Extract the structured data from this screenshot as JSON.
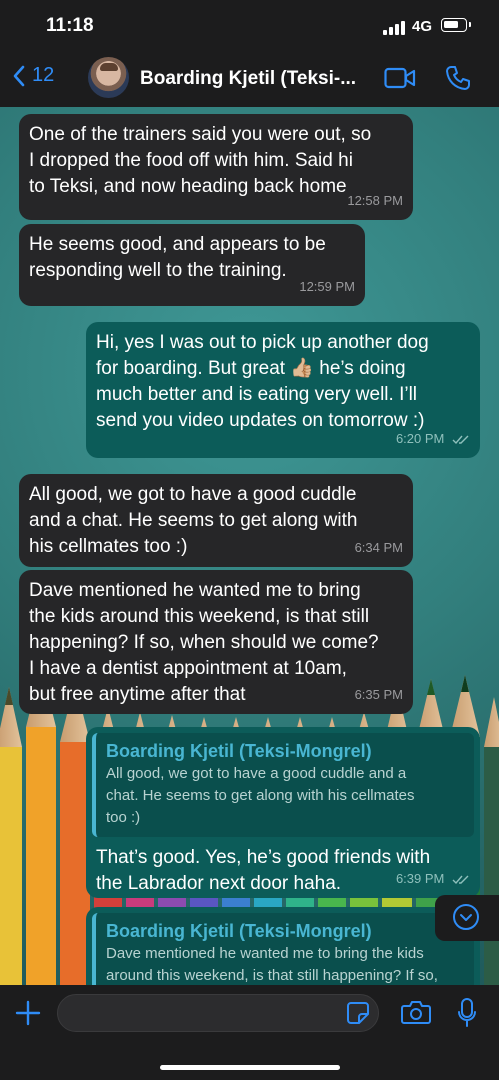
{
  "status": {
    "time": "11:18",
    "network": "4G"
  },
  "header": {
    "back_count": "12",
    "contact_name": "Boarding Kjetil (Teksi-..."
  },
  "messages": [
    {
      "dir": "in",
      "text": "One of the trainers said you were out, so\nI dropped the food off with him. Said hi\nto Teksi, and now heading back home",
      "time": "12:58 PM"
    },
    {
      "dir": "in",
      "text": "He seems good, and appears to be\nresponding well to the training.",
      "time": "12:59 PM"
    },
    {
      "dir": "out",
      "text": "Hi, yes I was out to pick up another dog\nfor boarding. But great 👍🏼 he’s doing\nmuch better and is eating very well. I’ll\nsend you video updates on tomorrow :)",
      "time": "6:20 PM"
    },
    {
      "dir": "in",
      "text": "All good, we got to have a good cuddle\nand a chat. He seems to get along with\nhis cellmates too :)",
      "time": "6:34 PM"
    },
    {
      "dir": "in",
      "text": "Dave mentioned he wanted me to bring\nthe kids around this weekend, is that still\nhappening? If so, when should we come?\nI have a dentist appointment at 10am,\nbut free anytime after that",
      "time": "6:35 PM"
    },
    {
      "dir": "out",
      "quote_name": "Boarding Kjetil (Teksi-Mongrel)",
      "quote_text": "All good, we got to have a good cuddle and a\nchat. He seems to get along with his cellmates\ntoo :)",
      "text": "That’s good. Yes, he’s good friends with\nthe Labrador next door haha.",
      "time": "6:39 PM"
    },
    {
      "dir": "out",
      "quote_name": "Boarding Kjetil (Teksi-Mongrel)",
      "quote_text": "Dave mentioned he wanted me to bring the kids\naround this weekend, is that still happening? If so,",
      "text": "",
      "time": ""
    }
  ],
  "composer": {
    "value": "",
    "placeholder": ""
  },
  "colors": {
    "accent": "#2f8cf6",
    "incoming_bubble": "#262628",
    "outgoing_bubble": "#0c5c59",
    "quote_name": "#49b6d2"
  }
}
